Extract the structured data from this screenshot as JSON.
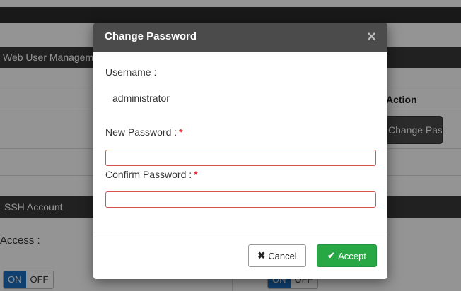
{
  "background": {
    "panel_left_title": "Web User Management",
    "panel_right_title": "",
    "column_header": "Action",
    "action_button_label": "Change Password",
    "panel2_left_title": "SSH Account",
    "access_label": "Access :",
    "toggle_on": "ON",
    "toggle_off": "OFF"
  },
  "modal": {
    "title": "Change Password",
    "close_glyph": "×",
    "username_label": "Username :",
    "username_value": "administrator",
    "new_password_label": "New Password :",
    "confirm_password_label": "Confirm Password :",
    "required_mark": "*",
    "new_password_value": "",
    "confirm_password_value": "",
    "cancel_icon": "✖",
    "cancel_label": "Cancel",
    "accept_icon": "✔",
    "accept_label": "Accept"
  },
  "colors": {
    "accept_green": "#28a745",
    "required_red": "#d9232d",
    "invalid_border": "#d9534f",
    "toggle_blue": "#1a6fc2"
  }
}
